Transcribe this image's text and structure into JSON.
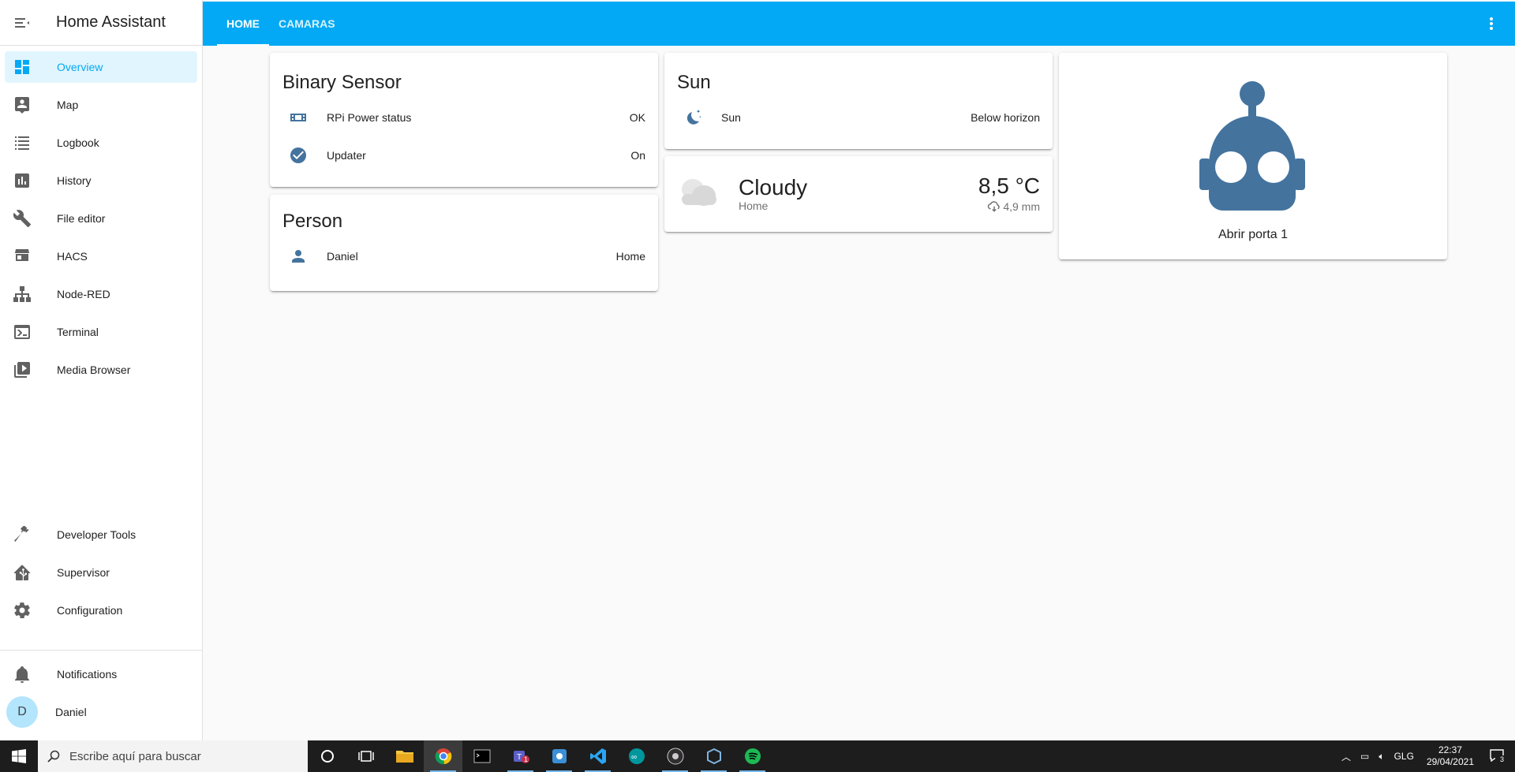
{
  "app": {
    "title": "Home Assistant"
  },
  "sidebar": {
    "items": [
      {
        "label": "Overview",
        "icon": "dashboard-icon",
        "active": true
      },
      {
        "label": "Map",
        "icon": "map-account-icon"
      },
      {
        "label": "Logbook",
        "icon": "list-icon"
      },
      {
        "label": "History",
        "icon": "chart-box-icon"
      },
      {
        "label": "File editor",
        "icon": "wrench-icon"
      },
      {
        "label": "HACS",
        "icon": "hacs-icon"
      },
      {
        "label": "Node-RED",
        "icon": "sitemap-icon"
      },
      {
        "label": "Terminal",
        "icon": "console-icon"
      },
      {
        "label": "Media Browser",
        "icon": "play-box-icon"
      }
    ],
    "bottom_items": [
      {
        "label": "Developer Tools",
        "icon": "hammer-icon"
      },
      {
        "label": "Supervisor",
        "icon": "home-assistant-icon"
      },
      {
        "label": "Configuration",
        "icon": "cog-icon"
      }
    ],
    "notifications_label": "Notifications",
    "user": {
      "initial": "D",
      "name": "Daniel"
    }
  },
  "header": {
    "tabs": [
      {
        "label": "HOME",
        "active": true
      },
      {
        "label": "CAMARAS",
        "active": false
      }
    ]
  },
  "cards": {
    "binary_sensor": {
      "title": "Binary Sensor",
      "rows": [
        {
          "name": "RPi Power status",
          "state": "OK",
          "icon": "raspberry-icon"
        },
        {
          "name": "Updater",
          "state": "On",
          "icon": "check-circle-icon"
        }
      ]
    },
    "person": {
      "title": "Person",
      "rows": [
        {
          "name": "Daniel",
          "state": "Home",
          "icon": "account-icon"
        }
      ]
    },
    "sun": {
      "title": "Sun",
      "rows": [
        {
          "name": "Sun",
          "state": "Below horizon",
          "icon": "weather-night-icon"
        }
      ]
    },
    "weather": {
      "condition": "Cloudy",
      "location": "Home",
      "temperature": "8,5 °C",
      "precipitation": "4,9 mm",
      "icon": "cloudy-icon"
    },
    "button": {
      "label": "Abrir porta 1",
      "icon": "robot-icon",
      "color": "#44739e"
    }
  },
  "taskbar": {
    "search_placeholder": "Escribe aquí para buscar",
    "language": "GLG",
    "time": "22:37",
    "date": "29/04/2021",
    "notification_count": "3",
    "teams_badge": "1"
  },
  "colors": {
    "accent": "#03a9f4",
    "icon": "#44739e",
    "sidebar_active_bg": "#e1f5fe"
  }
}
